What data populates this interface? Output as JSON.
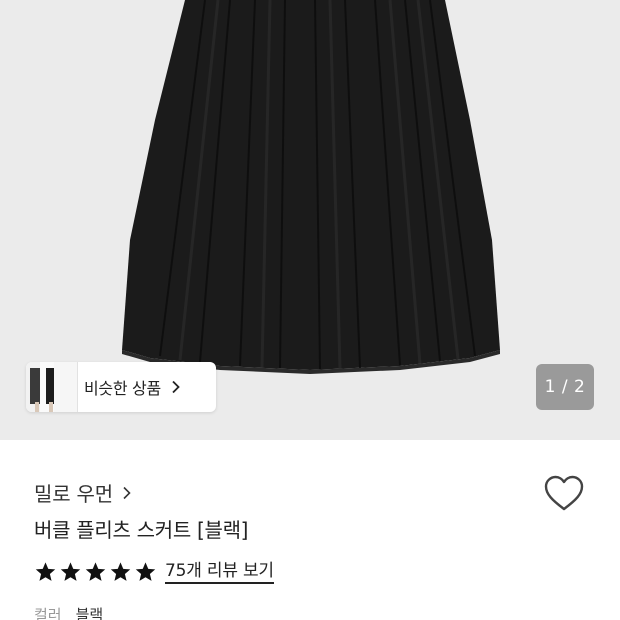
{
  "gallery": {
    "similar_label": "비슷한 상품",
    "pager": "1 / 2"
  },
  "product": {
    "brand": "밀로 우먼",
    "title": "버클 플리츠 스커트 [블랙]",
    "rating": 5,
    "review_link": "75개 리뷰 보기",
    "option_label": "컬러",
    "option_value": "블랙"
  },
  "colors": {
    "background": "#ebebeb",
    "skirt": "#1b1b1b",
    "pager_bg": "#8c8c8c"
  },
  "icons": {
    "wishlist": "heart-outline-icon",
    "star": "star-filled-icon",
    "chevron": "chevron-right-icon"
  }
}
